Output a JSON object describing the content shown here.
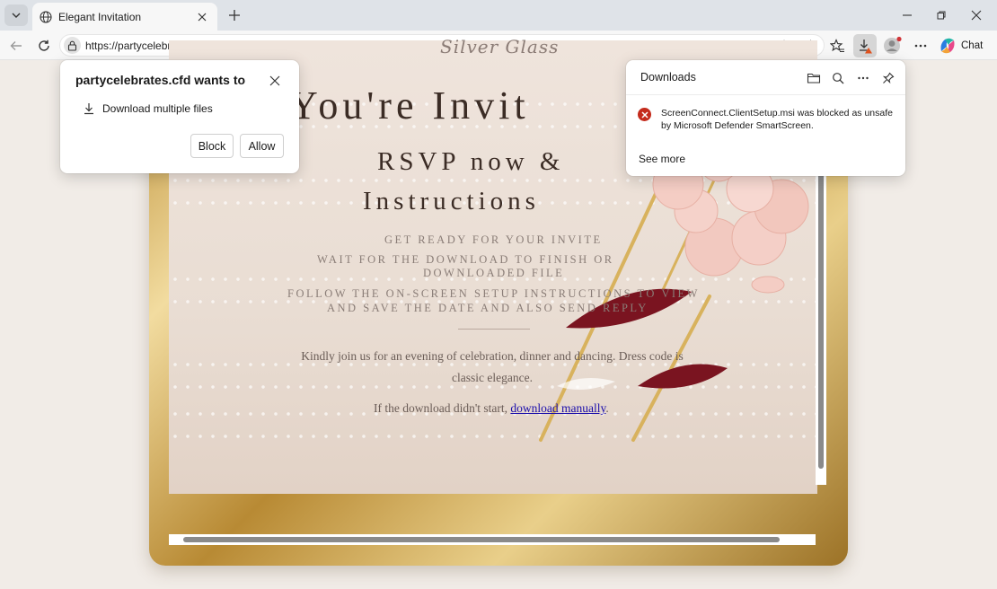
{
  "browser": {
    "tab": {
      "title": "Elegant Invitation"
    },
    "address": {
      "url": "https://partycelebrates.cfd"
    },
    "chat_label": "Chat"
  },
  "permission_popup": {
    "title": "partycelebrates.cfd wants to",
    "item": "Download multiple files",
    "block_label": "Block",
    "allow_label": "Allow"
  },
  "downloads_panel": {
    "title": "Downloads",
    "message": "ScreenConnect.ClientSetup.msi was blocked as unsafe by Microsoft Defender SmartScreen.",
    "see_more": "See more"
  },
  "page": {
    "brand": "Silver Glass",
    "headline": "You're Invit",
    "sub_line1": "RSVP now &",
    "sub_line2": "Instructions",
    "instructions": [
      "GET READY FOR YOUR INVITE",
      "WAIT FOR THE DOWNLOAD TO FINISH OR",
      "DOWNLOADED FILE",
      "FOLLOW THE ON-SCREEN SETUP INSTRUCTIONS TO VIEW",
      "AND SAVE THE DATE AND ALSO SEND REPLY"
    ],
    "body": "Kindly join us for an evening of celebration, dinner and dancing. Dress code is classic elegance.",
    "download_prefix": "If the download didn't start, ",
    "download_link": "download manually",
    "download_suffix": "."
  },
  "colors": {
    "accent_gold": "#c49a46",
    "error_red": "#c42b1c",
    "link_blue": "#1a0dab",
    "petal_red": "#7a1420",
    "petal_pink": "#f2c9c0"
  },
  "icons": [
    "tab-list-icon",
    "globe-icon",
    "close-icon",
    "plus-icon",
    "minimize-icon",
    "maximize-icon",
    "back-icon",
    "refresh-icon",
    "lock-icon",
    "read-aloud-icon",
    "favorite-star-icon",
    "favorites-icon",
    "download-icon",
    "profile-icon",
    "more-icon",
    "copilot-icon",
    "folder-icon",
    "search-icon",
    "pin-icon",
    "error-icon"
  ]
}
